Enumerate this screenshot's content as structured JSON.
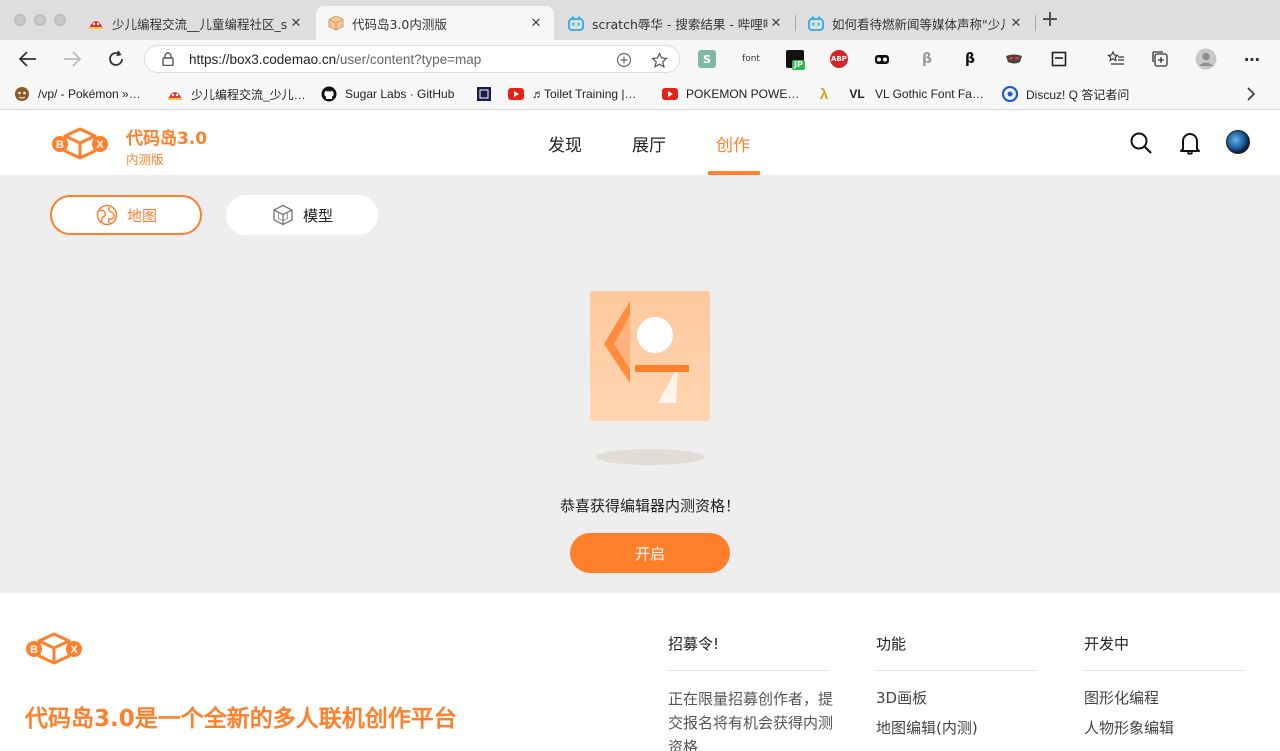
{
  "browser": {
    "tabs": [
      {
        "title": "少儿编程交流__儿童编程社区_sc",
        "icon": "codemao-community-icon"
      },
      {
        "title": "代码岛3.0内测版",
        "icon": "box3-icon",
        "active": true
      },
      {
        "title": "scratch辱华 - 搜索结果 - 哔哩哔",
        "icon": "bilibili-icon"
      },
      {
        "title": "如何看待燃新闻等媒体声称\"少儿",
        "icon": "bilibili-icon"
      }
    ],
    "new_tab": "+",
    "url_host": "https://box3.codemao.cn",
    "url_path": "/user/content?type=map",
    "bookmarks": [
      {
        "label": "/vp/ - Pokémon »…",
        "icon": "pokemon-icon"
      },
      {
        "label": "少儿编程交流_少儿…",
        "icon": "codemao-community-icon"
      },
      {
        "label": "Sugar Labs · GitHub",
        "icon": "github-icon"
      },
      {
        "label": "",
        "icon": "square-bookmark-icon"
      },
      {
        "label": "♬Toilet Training |…",
        "icon": "youtube-icon"
      },
      {
        "label": "POKEMON POWE…",
        "icon": "youtube-icon"
      },
      {
        "label": "",
        "icon": "lambda-icon"
      },
      {
        "label": "VL Gothic Font Fa…",
        "icon": "vl-icon"
      },
      {
        "label": "Discuz! Q 答记者问",
        "icon": "discuz-icon"
      }
    ],
    "ext_labels": {
      "font": "font",
      "abp": "ABP",
      "jp": "JP",
      "vl": "VL",
      "s": "S"
    }
  },
  "site": {
    "logo_title": "代码岛3.0",
    "logo_subtitle": "内测版",
    "nav": [
      "发现",
      "展厅",
      "创作"
    ],
    "active_nav": "创作",
    "accent": "#ff7f2a"
  },
  "content": {
    "tab_map": "地图",
    "tab_model": "模型",
    "message": "恭喜获得编辑器内测资格！",
    "start_button": "开启"
  },
  "footer": {
    "slogan": "代码岛3.0是一个全新的多人联机创作平台",
    "columns": [
      {
        "title": "招募令!",
        "text": "正在限量招募创作者，提交报名将有机会获得内测资格"
      },
      {
        "title": "功能",
        "items": [
          "3D画板",
          "地图编辑(内测)"
        ]
      },
      {
        "title": "开发中",
        "items": [
          "图形化编程",
          "人物形象编辑"
        ]
      }
    ]
  }
}
